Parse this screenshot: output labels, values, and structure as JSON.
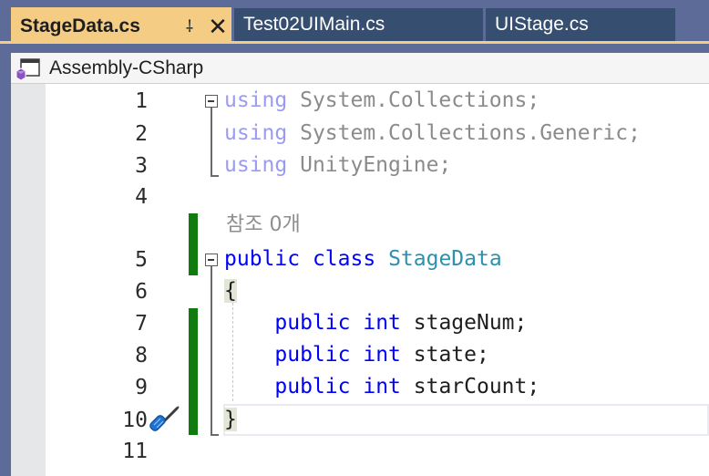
{
  "tabs": [
    {
      "label": "StageData.cs",
      "active": true,
      "pin_icon": "pin-icon",
      "close_icon": "close-icon"
    },
    {
      "label": "Test02UIMain.cs",
      "active": false
    },
    {
      "label": "UIStage.cs",
      "active": false
    }
  ],
  "navbar": {
    "project_icon": "csharp-project-icon",
    "project": "Assembly-CSharp"
  },
  "editor": {
    "line_numbers": [
      "1",
      "2",
      "3",
      "4",
      "5",
      "6",
      "7",
      "8",
      "9",
      "10",
      "11"
    ],
    "codelens": "참조 0개",
    "lines": {
      "l1": {
        "kw": "using",
        "rest": " System.Collections;"
      },
      "l2": {
        "kw": "using",
        "rest": " System.Collections.Generic;"
      },
      "l3": {
        "kw": "using",
        "rest": " UnityEngine;"
      },
      "l5": {
        "kw1": "public",
        "kw2": "class",
        "type": "StageData"
      },
      "l6": {
        "text": "{"
      },
      "l7": {
        "kw1": "public",
        "kw2": "int",
        "name": "stageNum;"
      },
      "l8": {
        "kw1": "public",
        "kw2": "int",
        "name": "state;"
      },
      "l9": {
        "kw1": "public",
        "kw2": "int",
        "name": "starCount;"
      },
      "l10": {
        "text": "}"
      }
    },
    "quick_action_icon": "screwdriver-icon",
    "colors": {
      "keyword": "#0000ff",
      "type": "#2b91af",
      "changed": "#107c10",
      "active_tab": "#f5cc84"
    }
  }
}
